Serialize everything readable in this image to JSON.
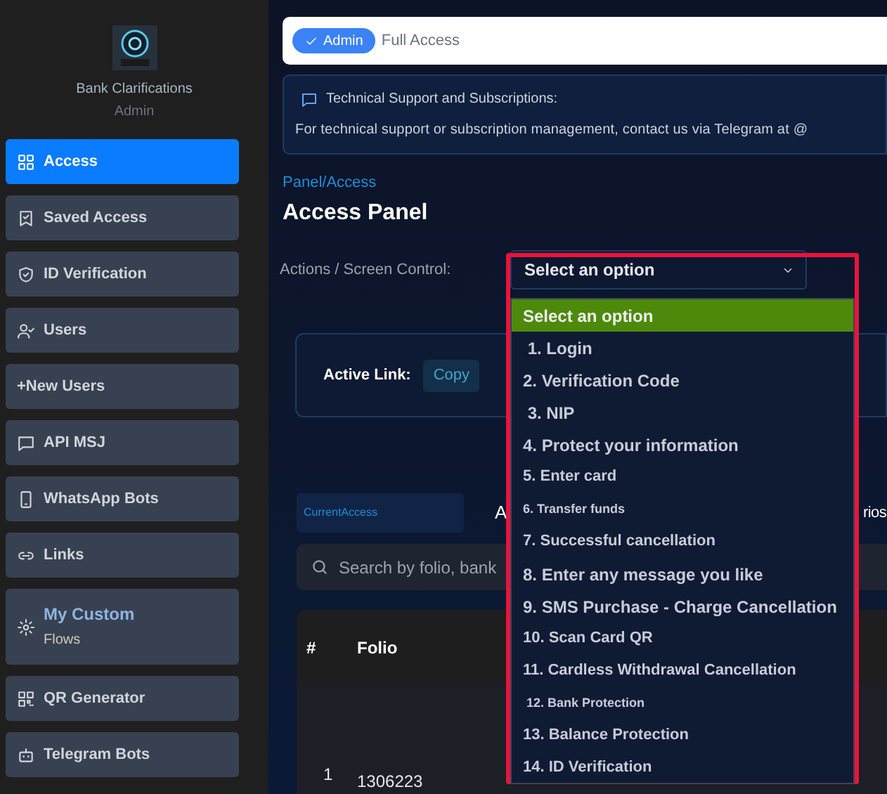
{
  "sidebar": {
    "brand": "Bank Clarifications",
    "role": "Admin",
    "items": [
      {
        "label": "Access",
        "selected": true
      },
      {
        "label": "Saved Access",
        "selected": false
      },
      {
        "label": "ID Verification",
        "selected": false
      },
      {
        "label": "Users",
        "selected": false
      },
      {
        "label": "+New Users",
        "selected": false
      },
      {
        "label": "API MSJ",
        "selected": false
      },
      {
        "label": "WhatsApp Bots",
        "selected": false
      },
      {
        "label": "Links",
        "selected": false
      },
      {
        "label": "My Custom",
        "sublabel": "Flows",
        "selected": false
      },
      {
        "label": "QR Generator",
        "selected": false
      },
      {
        "label": "Telegram Bots",
        "selected": false
      }
    ]
  },
  "top_bar": {
    "badge": "Admin",
    "text": "Full Access"
  },
  "notice": {
    "title": "Technical Support and Subscriptions:",
    "text": "For technical support or subscription management, contact us via Telegram at @"
  },
  "breadcrumb": "Panel/Access",
  "title": "Access Panel",
  "control": {
    "label": "Actions / Screen Control:",
    "value": "Select an option",
    "expanded": true,
    "options": [
      {
        "label": "Select an option",
        "kind": "normal",
        "selected": true
      },
      {
        "label": " 1. Login",
        "kind": "normal",
        "selected": false
      },
      {
        "label": "2. Verification Code",
        "kind": "normal",
        "selected": false
      },
      {
        "label": " 3. NIP",
        "kind": "normal",
        "selected": false
      },
      {
        "label": "4. Protect your information",
        "kind": "normal",
        "selected": false
      },
      {
        "label": "5. Enter card",
        "kind": "medium",
        "selected": false
      },
      {
        "label": "6. Transfer funds",
        "kind": "small",
        "selected": false
      },
      {
        "label": "7. Successful cancellation",
        "kind": "medium",
        "selected": false
      },
      {
        "label": "8. Enter any message you like",
        "kind": "normal",
        "selected": false
      },
      {
        "label": "9. SMS Purchase - Charge Cancellation",
        "kind": "normal",
        "selected": false
      },
      {
        "label": "10. Scan Card QR",
        "kind": "medium",
        "selected": false
      },
      {
        "label": "11. Cardless Withdrawal Cancellation",
        "kind": "medium",
        "selected": false
      },
      {
        "label": " 12. Bank Protection",
        "kind": "small",
        "selected": false
      },
      {
        "label": "13. Balance Protection",
        "kind": "medium",
        "selected": false
      },
      {
        "label": "14. ID Verification",
        "kind": "medium",
        "selected": false
      }
    ]
  },
  "active_link": {
    "label": "Active Link:",
    "button": "Copy"
  },
  "tabs": [
    {
      "label": "CurrentAccess",
      "selected": true
    },
    {
      "label": "A",
      "selected": false
    },
    {
      "label": "rios",
      "selected": false
    }
  ],
  "search": {
    "placeholder": "Search by folio, bank"
  },
  "table": {
    "columns": [
      "#",
      "Folio"
    ],
    "rows": [
      {
        "cells": [
          "1",
          "1306223"
        ]
      }
    ]
  }
}
